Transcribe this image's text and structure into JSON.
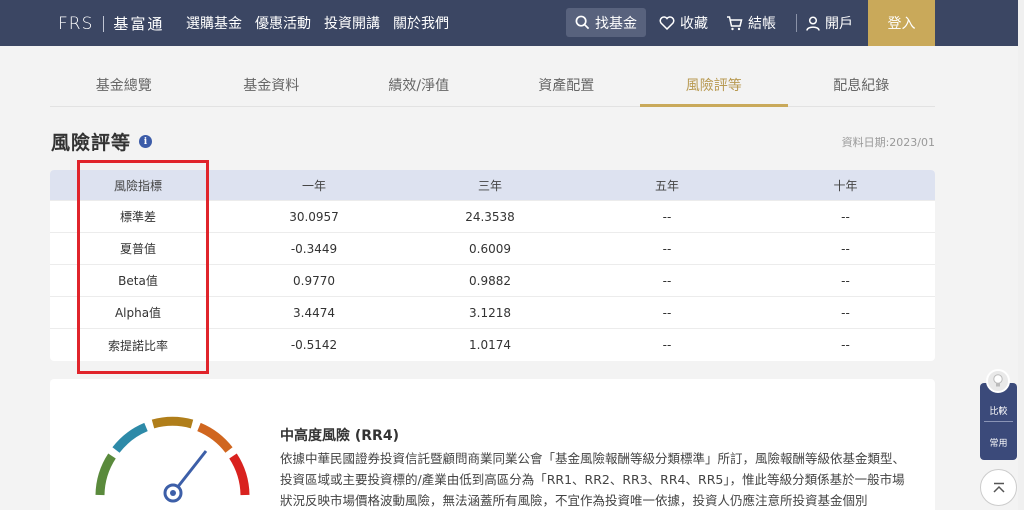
{
  "header": {
    "logo_mark": "FRS",
    "logo_name": "基富通",
    "nav": [
      "選購基金",
      "優惠活動",
      "投資開講",
      "關於我們"
    ],
    "find_fund": "找基金",
    "favorites": "收藏",
    "checkout": "結帳",
    "open_account": "開戶",
    "login": "登入"
  },
  "tabs": [
    "基金總覽",
    "基金資料",
    "績效/淨值",
    "資產配置",
    "風險評等",
    "配息紀錄"
  ],
  "active_tab": 4,
  "section": {
    "title": "風險評等",
    "info_icon": "i",
    "data_date": "資料日期:2023/01"
  },
  "table": {
    "headers": [
      "風險指標",
      "一年",
      "三年",
      "五年",
      "十年"
    ],
    "rows": [
      [
        "標準差",
        "30.0957",
        "24.3538",
        "--",
        "--"
      ],
      [
        "夏普值",
        "-0.3449",
        "0.6009",
        "--",
        "--"
      ],
      [
        "Beta值",
        "0.9770",
        "0.9882",
        "--",
        "--"
      ],
      [
        "Alpha值",
        "3.4474",
        "3.1218",
        "--",
        "--"
      ],
      [
        "索提諾比率",
        "-0.5142",
        "1.0174",
        "--",
        "--"
      ]
    ]
  },
  "risk": {
    "title": "中高度風險 (RR4)",
    "text": "依據中華民國證券投資信託暨顧問商業同業公會「基金風險報酬等級分類標準」所訂，風險報酬等級依基金類型、投資區域或主要投資標的/產業由低到高區分為「RR1、RR2、RR3、RR4、RR5」，惟此等級分類係基於一般市場狀況反映市場價格波動風險，無法涵蓋所有風險，不宜作為投資唯一依據，投資人仍應注意所投資基金個別"
  },
  "floating": {
    "compare": "比較",
    "common": "常用"
  },
  "colors": {
    "header_bg": "#3b4663",
    "accent_gold": "#c9a95a",
    "table_head_bg": "#dde2f0",
    "highlight_box": "#e0242b",
    "float_bg": "#3b4a7a"
  },
  "icons": {
    "find": "search-icon",
    "favorites": "heart-icon",
    "checkout": "cart-icon",
    "account": "user-icon",
    "info": "info-icon",
    "bulb": "lightbulb-icon",
    "top": "arrow-up-icon"
  }
}
